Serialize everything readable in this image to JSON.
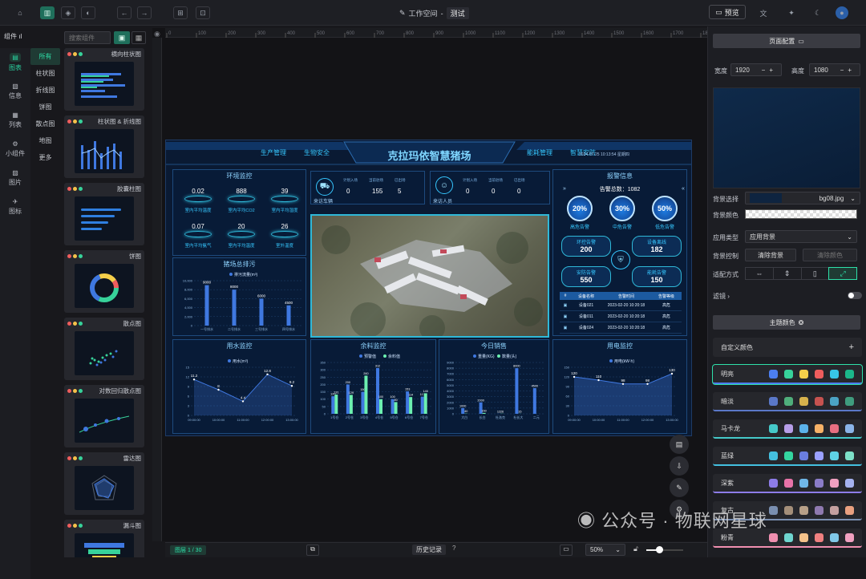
{
  "toolbar": {
    "workspace_label": "工作空间",
    "project_name": "测试",
    "preview_label": "预览"
  },
  "left": {
    "header": "组件",
    "search_placeholder": "搜索组件",
    "nav": [
      {
        "label": "图表",
        "icon": "chart-icon"
      },
      {
        "label": "信息",
        "icon": "info-icon"
      },
      {
        "label": "列表",
        "icon": "table-icon"
      },
      {
        "label": "小组件",
        "icon": "widget-icon"
      },
      {
        "label": "图片",
        "icon": "image-icon"
      },
      {
        "label": "图标",
        "icon": "icon-icon"
      }
    ],
    "categories": [
      "所有",
      "柱状图",
      "折线图",
      "饼图",
      "散点图",
      "地图",
      "更多"
    ],
    "components": [
      "横向柱状图",
      "柱状图 & 折线图",
      "胶囊柱图",
      "饼图",
      "散点图",
      "对数回归散点图",
      "雷达图",
      "漏斗图"
    ]
  },
  "screen": {
    "title": "克拉玛依智慧猪场",
    "nav_left": [
      "生产管理",
      "生物安全"
    ],
    "nav_right": [
      "能耗管理",
      "智慧安防"
    ],
    "datetime": "2024-07-25 10:13:54 星期四",
    "env": {
      "title": "环境监控",
      "items": [
        {
          "v": "0.02",
          "l": "室内平均温度"
        },
        {
          "v": "888",
          "l": "室内平均CO2"
        },
        {
          "v": "39",
          "l": "室内平均湿度"
        },
        {
          "v": "0.07",
          "l": "室内平均氨气"
        },
        {
          "v": "20",
          "l": "室内平均温度"
        },
        {
          "v": "26",
          "l": "室外温度"
        }
      ]
    },
    "vehicles": {
      "label": "来访车辆",
      "heads": [
        "计划入场",
        "当前驻场",
        "已出场"
      ],
      "values": [
        "0",
        "155",
        "5"
      ]
    },
    "visitors": {
      "label": "来访人员",
      "heads": [
        "计划入场",
        "当前驻场",
        "已出场"
      ],
      "values": [
        "0",
        "0",
        "0"
      ]
    },
    "discharge": {
      "title": "猪场总排污",
      "legend": "排污流量(m³)",
      "categories": [
        "一号排水",
        "二号排水",
        "三号排水",
        "四号排水"
      ],
      "values": [
        9000,
        8000,
        6000,
        4500
      ],
      "yticks": [
        "10,000",
        "8,000",
        "6,000",
        "4,000",
        "2,000",
        "0"
      ]
    },
    "alarm": {
      "title": "报警信息",
      "total_label": "告警总数：",
      "total": "1082",
      "rings": [
        {
          "v": "20%",
          "l": "高危告警"
        },
        {
          "v": "30%",
          "l": "中危告警"
        },
        {
          "v": "50%",
          "l": "低危告警"
        }
      ],
      "boxes": [
        {
          "l": "环控告警",
          "v": "200"
        },
        {
          "l": "设备离线",
          "v": "182"
        },
        {
          "l": "安防告警",
          "v": "550"
        },
        {
          "l": "能耗告警",
          "v": "150"
        }
      ],
      "table_head": [
        "#",
        "设备名称",
        "告警时间",
        "告警等级"
      ],
      "rows": [
        [
          "设备021",
          "2023-02-20 10:20:18",
          "高危"
        ],
        [
          "设备011",
          "2023-02-20 10:20:18",
          "高危"
        ],
        [
          "设备024",
          "2023-02-20 10:20:18",
          "高危"
        ]
      ]
    },
    "water": {
      "title": "用水监控",
      "legend": "用水(m³)",
      "x": [
        "09:00:00",
        "10:00:00",
        "11:00:00",
        "12:00:00",
        "13:00:00"
      ],
      "values": [
        11.2,
        8,
        4.4,
        12.8,
        9.2
      ],
      "yticks": [
        "15",
        "12",
        "9",
        "6",
        "3",
        "0"
      ]
    },
    "feed": {
      "title": "余料监控",
      "legend": [
        "预警值",
        "余料值"
      ],
      "categories": [
        "1号仓",
        "2号仓",
        "3号仓",
        "4号仓",
        "5号仓",
        "6号仓",
        "7号仓"
      ],
      "s1": [
        120,
        200,
        150,
        312,
        100,
        153,
        117
      ],
      "s2": [
        131,
        129,
        260,
        100,
        80,
        114,
        140
      ],
      "yticks": [
        "350",
        "300",
        "250",
        "200",
        "150",
        "100",
        "50",
        "0"
      ]
    },
    "sales": {
      "title": "今日销售",
      "legend": [
        "重量(KG)",
        "数量(头)"
      ],
      "categories": [
        "大白",
        "长白",
        "杜洛克",
        "杜长大",
        "二元"
      ],
      "s1": [
        1000,
        2000,
        12,
        8000,
        4500
      ],
      "s2": [
        40,
        150,
        26,
        15,
        0
      ],
      "yticks": [
        "9000",
        "8000",
        "7000",
        "6000",
        "5000",
        "4000",
        "3000",
        "2000",
        "1000",
        "0"
      ]
    },
    "power": {
      "title": "用电监控",
      "legend": "用电(kW·h)",
      "x": [
        "09:00:00",
        "10:00:00",
        "11:00:00",
        "12:00:00",
        "13:00:00"
      ],
      "values": [
        120,
        110,
        98,
        98,
        130
      ],
      "yticks": [
        "150",
        "120",
        "90",
        "60",
        "30",
        "0"
      ]
    }
  },
  "right": {
    "page_config": "页面配置",
    "width_label": "宽度",
    "width": "1920",
    "height_label": "高度",
    "height": "1080",
    "bg_select_label": "背景选择",
    "bg_file": "bg08.jpg",
    "bg_color_label": "背景颜色",
    "apply_type_label": "应用类型",
    "apply_type": "应用背景",
    "bg_control_label": "背景控制",
    "clear_bg": "清除背景",
    "clear_color": "清除颜色",
    "fit_label": "适配方式",
    "filter_label": "滤镜",
    "theme_btn": "主题颜色",
    "custom_color": "自定义颜色",
    "themes": [
      {
        "name": "明亮",
        "colors": [
          "#4c7ef0",
          "#37d29a",
          "#f5cf4a",
          "#ef5d5d",
          "#37c5e8",
          "#1bb78a"
        ]
      },
      {
        "name": "暗淡",
        "colors": [
          "#5a78c8",
          "#4fae7b",
          "#d7b24c",
          "#c6524f",
          "#4ba3c4",
          "#3f9c7e"
        ]
      },
      {
        "name": "马卡龙",
        "colors": [
          "#45c9c9",
          "#b79ee8",
          "#5bb3ea",
          "#f7b267",
          "#e86f81",
          "#8ab4e8"
        ]
      },
      {
        "name": "蓝绿",
        "colors": [
          "#44c0e0",
          "#34d6a0",
          "#6a7ee0",
          "#9aa0ff",
          "#5fd2e6",
          "#7de0c8"
        ]
      },
      {
        "name": "深紫",
        "colors": [
          "#8d7ce8",
          "#e873a8",
          "#6fb7e8",
          "#8a7cc8",
          "#f0a0c0",
          "#a5b2f0"
        ]
      },
      {
        "name": "复古",
        "colors": [
          "#7a8fb0",
          "#a48f7a",
          "#b7a088",
          "#8f7ab0",
          "#c4a0a0",
          "#e9a080"
        ]
      },
      {
        "name": "粉青",
        "colors": [
          "#f08fb0",
          "#6fd6d0",
          "#f5c28a",
          "#f08080",
          "#80c8e8",
          "#f0a0c0"
        ]
      }
    ]
  },
  "bottom": {
    "layer_label": "图层 1 / 30",
    "history_label": "历史记录",
    "zoom": "50%"
  },
  "watermark": "公众号 · 物联网星球"
}
